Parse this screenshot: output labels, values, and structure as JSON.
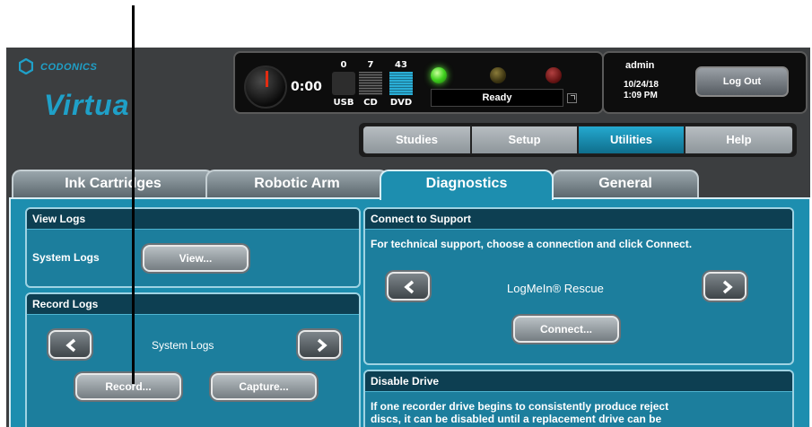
{
  "brand": {
    "company": "CODONICS",
    "product": "Virtua"
  },
  "status": {
    "timer": "0:00",
    "usb_count": "",
    "usb_label": "USB",
    "cd_count": "7",
    "cd_label": "CD",
    "dvd_count": "43",
    "dvd_label": "DVD",
    "usb_top": "0",
    "message": "Ready"
  },
  "user": {
    "name": "admin",
    "date": "10/24/18",
    "time": "1:09 PM",
    "logout_label": "Log Out"
  },
  "nav": {
    "studies": "Studies",
    "setup": "Setup",
    "utilities": "Utilities",
    "help": "Help"
  },
  "tabs": {
    "ink": "Ink Cartridges",
    "robotic": "Robotic Arm",
    "diagnostics": "Diagnostics",
    "general": "General"
  },
  "view_logs": {
    "title": "View Logs",
    "label": "System Logs",
    "button": "View..."
  },
  "record_logs": {
    "title": "Record Logs",
    "selection": "System Logs",
    "record_button": "Record...",
    "capture_button": "Capture..."
  },
  "support": {
    "title": "Connect to Support",
    "description": "For technical support, choose a connection and click Connect.",
    "selection": "LogMeIn® Rescue",
    "connect_button": "Connect..."
  },
  "disable_drive": {
    "title": "Disable Drive",
    "line1": "If one recorder drive begins to consistently produce reject",
    "line2": "discs, it can be disabled until a replacement drive can be"
  },
  "colors": {
    "accent": "#1d8eaf",
    "header": "#0d3f52",
    "active_nav": "#1a93b8"
  }
}
